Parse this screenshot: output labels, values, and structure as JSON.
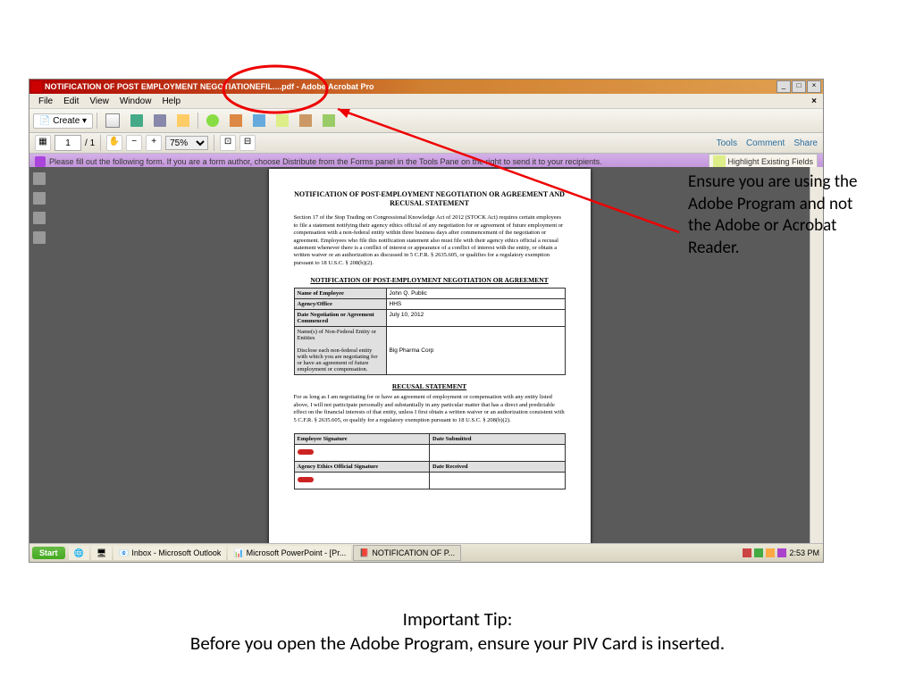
{
  "window": {
    "title": "NOTIFICATION OF POST EMPLOYMENT NEGOTIATIONEFIL....pdf - Adobe Acrobat Pro"
  },
  "menus": [
    "File",
    "Edit",
    "View",
    "Window",
    "Help"
  ],
  "toolbar": {
    "create_label": "Create"
  },
  "pagebar": {
    "current": "1",
    "total": "1",
    "zoom": "75%",
    "tools": "Tools",
    "comment": "Comment",
    "share": "Share"
  },
  "formbar": {
    "message": "Please fill out the following form. If you are a form author, choose Distribute from the Forms panel in the Tools Pane on the right to send it to your recipients.",
    "highlight": "Highlight Existing Fields"
  },
  "doc": {
    "title": "NOTIFICATION OF POST-EMPLOYMENT NEGOTIATION OR AGREEMENT AND RECUSAL STATEMENT",
    "para1": "Section 17 of the Stop Trading on Congressional Knowledge Act of 2012 (STOCK Act) requires certain employees to file a statement notifying their agency ethics official of any negotiation for or agreement of future employment or compensation with a non-federal entity within three business days after commencement of the negotiation or agreement.  Employees who file this notification statement also must file with their agency ethics official a recusal statement whenever there is a conflict of interest or appearance of a conflict of interest with the entity, or obtain a written waiver or an authorization as discussed in 5 C.F.R. § 2635.605, or qualifies for a regulatory exemption pursuant to 18 U.S.C. § 208(b)(2).",
    "h2a": "NOTIFICATION OF POST-EMPLOYMENT NEGOTIATION OR AGREEMENT",
    "f1l": "Name of Employee",
    "f1v": "John Q. Public",
    "f2l": "Agency/Office",
    "f2v": "HHS",
    "f3l": "Date Negotiation or Agreement Commenced",
    "f3v": "July 10, 2012",
    "f4l": "Name(s) of Non-Federal Entity or Entities\n\nDisclose each non-federal entity with which you are negotiating for or have an agreement of future employment or compensation.",
    "f4v": "Big Pharma Corp",
    "h2b": "RECUSAL STATEMENT",
    "para2": "For as long as I am negotiating for or have an agreement of employment or compensation with any entity listed above, I will not participate personally and substantially in any particular matter that has a direct and predictable effect on the financial interests of that entity, unless I first obtain a written waiver or an authorization consistent with 5 C.F.R. § 2635.605, or qualify for a regulatory exemption pursuant to 18 U.S.C. § 208(b)(2).",
    "sig1": "Employee Signature",
    "sig2": "Date Submitted",
    "sig3": "Agency Ethics Official Signature",
    "sig4": "Date Received"
  },
  "callout": "Ensure you are using the Adobe Program and not the Adobe or Acrobat Reader.",
  "tip_title": "Important Tip:",
  "tip_body": "Before you open the Adobe Program, ensure your PIV Card is inserted.",
  "taskbar": {
    "start": "Start",
    "item1": "Inbox - Microsoft Outlook",
    "item2": "Microsoft PowerPoint - [Pr...",
    "item3": "NOTIFICATION OF P...",
    "time": "2:53 PM"
  }
}
